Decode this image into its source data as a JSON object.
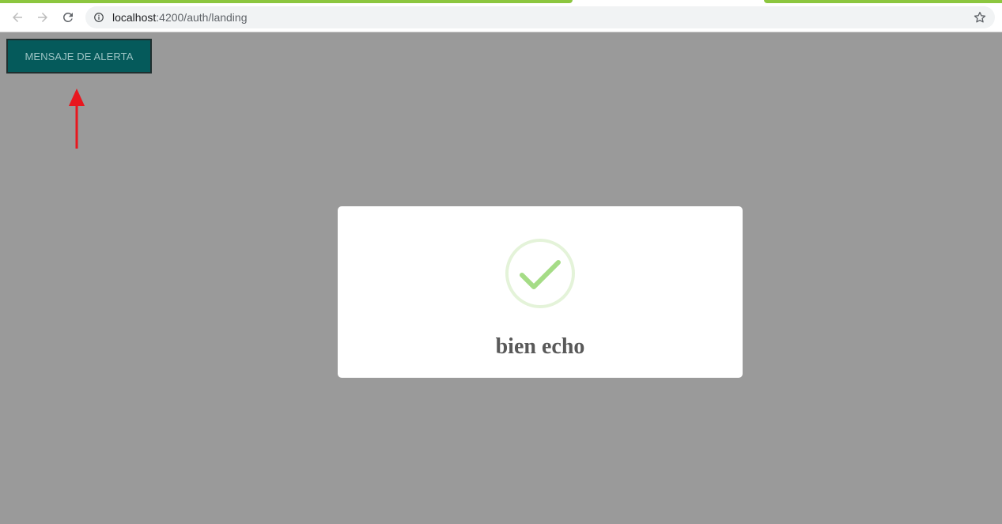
{
  "browser": {
    "url_host": "localhost",
    "url_path": ":4200/auth/landing",
    "back_icon": "arrow-left-icon",
    "forward_icon": "arrow-right-icon",
    "reload_icon": "reload-icon",
    "info_icon": "info-icon",
    "bookmark_icon": "star-icon",
    "loading_color": "#8cc63f"
  },
  "page": {
    "alert_button_label": "MENSAJE DE ALERTA",
    "alert_button_color": "#055a5b",
    "annotation_arrow_color": "#e8171f"
  },
  "modal": {
    "icon": "success-check-icon",
    "icon_color": "#a5dc86",
    "title": "bien echo"
  }
}
